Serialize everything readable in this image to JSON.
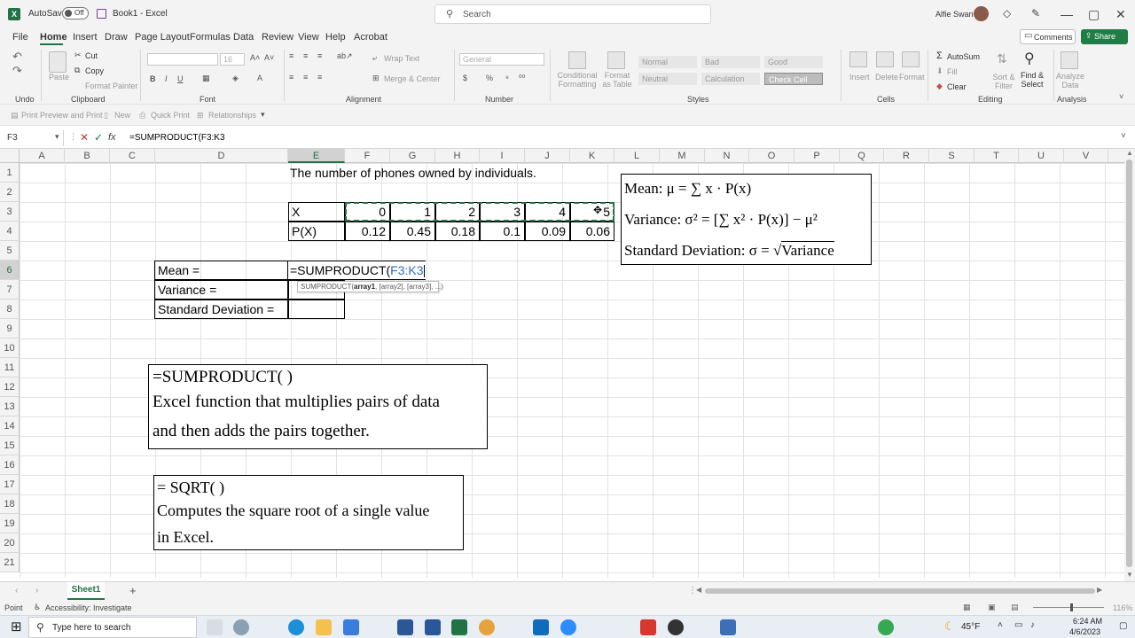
{
  "window": {
    "autosave_label": "AutoSave",
    "autosave_state": "Off",
    "title": "Book1 - Excel",
    "search_placeholder": "Search",
    "user_name": "Alfie Swan",
    "min_label": "—",
    "max_label": "▢",
    "close_label": "✕"
  },
  "menu": {
    "tabs": [
      "File",
      "Home",
      "Insert",
      "Draw",
      "Page Layout",
      "Formulas",
      "Data",
      "Review",
      "View",
      "Help",
      "Acrobat"
    ],
    "active": "Home",
    "comments_label": "Comments",
    "share_label": "Share"
  },
  "ribbon": {
    "groups": [
      "Undo",
      "Clipboard",
      "Font",
      "Alignment",
      "Number",
      "Styles",
      "Cells",
      "Editing",
      "Analysis"
    ],
    "paste_label": "Paste",
    "cut_label": "Cut",
    "copy_label": "Copy",
    "format_painter_label": "Format Painter",
    "font_size": "16",
    "wrap_text_label": "Wrap Text",
    "merge_center_label": "Merge & Center",
    "number_format": "General",
    "conditional_formatting_label": "Conditional Formatting",
    "format_as_table_label": "Format as Table",
    "style_cells": [
      "Normal",
      "Bad",
      "Good",
      "Neutral",
      "Calculation",
      "Check Cell"
    ],
    "insert_label": "Insert",
    "delete_label": "Delete",
    "format_label": "Format",
    "autosum_label": "AutoSum",
    "fill_label": "Fill",
    "clear_label": "Clear",
    "sort_filter_label": "Sort & Filter",
    "find_select_label": "Find & Select",
    "analyze_data_label": "Analyze Data"
  },
  "qat": {
    "items": [
      "Print Preview and Print",
      "New",
      "Quick Print",
      "Relationships"
    ]
  },
  "formula_bar": {
    "name_box": "F3",
    "fx_label": "fx",
    "formula": "=SUMPRODUCT(F3:K3"
  },
  "sheet": {
    "columns": [
      "A",
      "B",
      "C",
      "D",
      "E",
      "F",
      "G",
      "H",
      "I",
      "J",
      "K",
      "L",
      "M",
      "N",
      "O",
      "P",
      "Q",
      "R",
      "S",
      "T",
      "U",
      "V"
    ],
    "selected_column": "E",
    "rows": [
      "1",
      "2",
      "3",
      "4",
      "5",
      "6",
      "7",
      "8",
      "9",
      "10",
      "11",
      "12",
      "13",
      "14",
      "15",
      "16",
      "17",
      "18",
      "19",
      "20",
      "21"
    ],
    "selected_row": "6",
    "heading": "The number of phones owned by individuals.",
    "x_label": "X",
    "px_label": "P(X)",
    "x_values": [
      "0",
      "1",
      "2",
      "3",
      "4",
      "5"
    ],
    "p_values": [
      "0.12",
      "0.45",
      "0.18",
      "0.1",
      "0.09",
      "0.06"
    ],
    "mean_label": "Mean =",
    "variance_label": "Variance =",
    "sd_label": "Standard Deviation =",
    "editing_prefix": "=SUMPRODUCT(",
    "editing_ref": "F3:K3",
    "tooltip_func": "SUMPRODUCT(",
    "tooltip_arg1": "array1",
    "tooltip_rest": ", [array2], [array3], ...)"
  },
  "formula_box": {
    "mean_line": "Mean: μ = ∑ x · P(x)",
    "variance_line": "Variance: σ² = [∑ x² · P(x)] − μ²",
    "sd_prefix": "Standard Deviation: σ = √",
    "sd_radicand": "Variance"
  },
  "note_sumproduct": {
    "title": "=SUMPRODUCT( )",
    "line1": "Excel function that multiplies pairs of data",
    "line2": "and then adds the pairs together."
  },
  "note_sqrt": {
    "title": "= SQRT( )",
    "line1": "Computes the square root of a single value",
    "line2": "in Excel."
  },
  "tabs": {
    "sheet_name": "Sheet1",
    "add_label": "+"
  },
  "status": {
    "mode": "Point",
    "accessibility": "Accessibility: Investigate",
    "zoom": "116%"
  },
  "taskbar": {
    "search_placeholder": "Type here to search",
    "weather": "45°F",
    "time": "6:24 AM",
    "date": "4/6/2023"
  },
  "colors": {
    "excel_green": "#217346",
    "share_green": "#1e7e45",
    "marching_ants": "#217346",
    "ref_blue": "#2f6fc1"
  }
}
